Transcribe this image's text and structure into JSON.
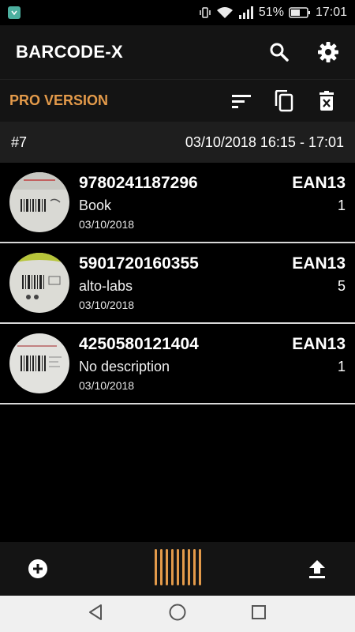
{
  "status_bar": {
    "battery_percent": "51%",
    "time": "17:01"
  },
  "app_bar": {
    "title": "BARCODE-X",
    "icons": [
      "search-icon",
      "settings-icon"
    ]
  },
  "pro_bar": {
    "label": "PRO VERSION",
    "icons": [
      "sort-icon",
      "copy-icon",
      "delete-icon"
    ]
  },
  "session": {
    "number": "#7",
    "date_range": "03/10/2018 16:15 - 17:01"
  },
  "items": [
    {
      "code": "9780241187296",
      "type": "EAN13",
      "description": "Book",
      "quantity": "1",
      "date": "03/10/2018"
    },
    {
      "code": "5901720160355",
      "type": "EAN13",
      "description": "alto-labs",
      "quantity": "5",
      "date": "03/10/2018"
    },
    {
      "code": "4250580121404",
      "type": "EAN13",
      "description": "No description",
      "quantity": "1",
      "date": "03/10/2018"
    }
  ],
  "bottom_bar": {
    "icons": [
      "add-icon",
      "barcode-scan-icon",
      "upload-icon"
    ],
    "accent_color": "#e39a4a"
  },
  "nav_bar": {
    "icons": [
      "back-icon",
      "home-icon",
      "recents-icon"
    ]
  }
}
